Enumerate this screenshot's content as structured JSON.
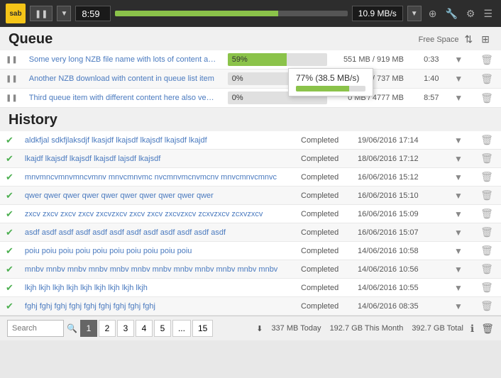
{
  "topbar": {
    "logo": "sab",
    "pause_label": "❚❚",
    "timer": "8:59",
    "speed": "10.9 MB/s",
    "icons": [
      "⊕",
      "🔧",
      "⚙",
      "☰"
    ]
  },
  "popup": {
    "text": "77% (38.5 MB/s)"
  },
  "queue": {
    "title": "Queue",
    "free_space": "Free Space",
    "rows": [
      {
        "filename": "Some very long NZB file name with lots of content and text here",
        "progress": 59,
        "progress_label": "59%",
        "size": "551 MB / 919 MB",
        "eta": "0:33"
      },
      {
        "filename": "Another NZB download with content in queue list item",
        "progress": 0,
        "progress_label": "0%",
        "size": "0 MB / 737 MB",
        "eta": "1:40"
      },
      {
        "filename": "Third queue item with different content here also very long",
        "progress": 0,
        "progress_label": "0%",
        "size": "0 MB / 4777 MB",
        "eta": "8:57"
      }
    ]
  },
  "history": {
    "title": "History",
    "rows": [
      {
        "filename": "aldkfjal sdkfjlaksdjf lkasjdf lkajsdf lkajsdf lkajsdf lkajdf",
        "status": "Completed",
        "date": "19/06/2016 17:14"
      },
      {
        "filename": "lkajdf lkajsdf lkajsdf lkajsdf lajsdf lkajsdf",
        "status": "Completed",
        "date": "18/06/2016 17:12"
      },
      {
        "filename": "mnvmncvmnvmncvmnv mnvcmnvmc nvcmnvmcnvmcnv mnvcmnvcmnvc",
        "status": "Completed",
        "date": "16/06/2016 15:12"
      },
      {
        "filename": "qwer qwer qwer qwer qwer qwer qwer qwer qwer qwer",
        "status": "Completed",
        "date": "16/06/2016 15:10"
      },
      {
        "filename": "zxcv zxcv zxcv zxcv zxcvzxcv zxcv zxcv zxcvzxcv zcxvzxcv zcxvzxcv",
        "status": "Completed",
        "date": "16/06/2016 15:09"
      },
      {
        "filename": "asdf asdf asdf asdf asdf asdf asdf asdf asdf asdf asdf asdf",
        "status": "Completed",
        "date": "16/06/2016 15:07"
      },
      {
        "filename": "poiu poiu poiu poiu poiu poiu poiu poiu poiu poiu",
        "status": "Completed",
        "date": "14/06/2016 10:58"
      },
      {
        "filename": "mnbv mnbv mnbv mnbv mnbv mnbv mnbv mnbv mnbv mnbv mnbv mnbv",
        "status": "Completed",
        "date": "14/06/2016 10:56"
      },
      {
        "filename": "lkjh lkjh lkjh lkjh lkjh lkjh lkjh lkjh lkjh",
        "status": "Completed",
        "date": "14/06/2016 10:55"
      },
      {
        "filename": "fghj fghj fghj fghj fghj fghj fghj fghj fghj",
        "status": "Completed",
        "date": "14/06/2016 08:35"
      }
    ]
  },
  "footer": {
    "search_placeholder": "Search",
    "pages": [
      "1",
      "2",
      "3",
      "4",
      "5",
      "...",
      "15"
    ],
    "active_page": "1",
    "stats": {
      "today": "337 MB Today",
      "month": "192.7 GB This Month",
      "total": "392.7 GB Total"
    }
  }
}
